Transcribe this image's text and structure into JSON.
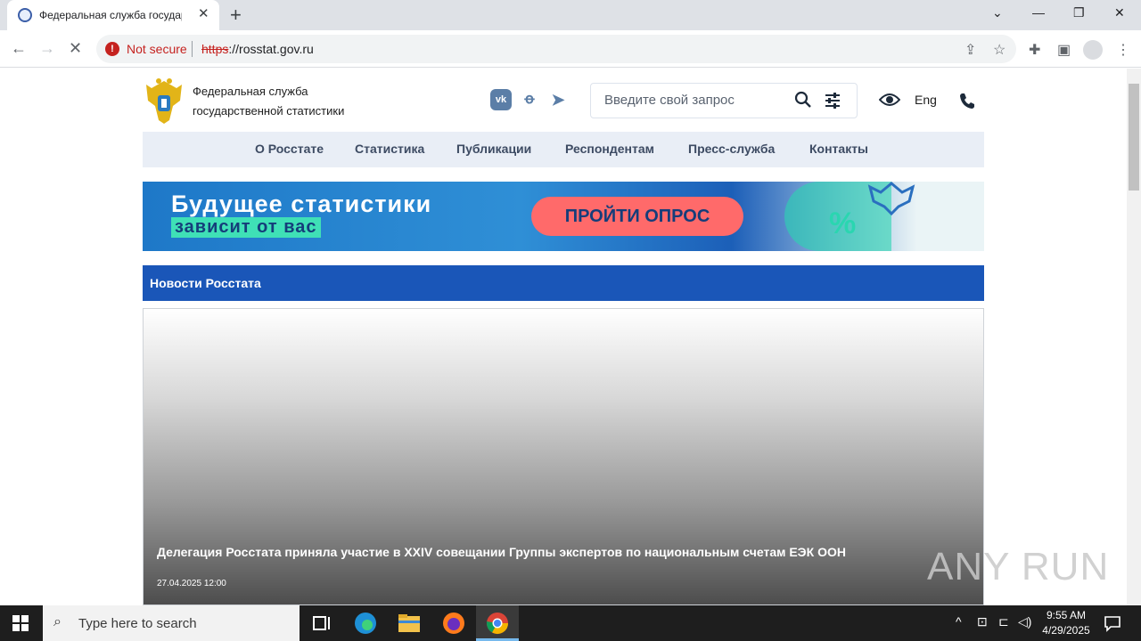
{
  "browser": {
    "tab_title": "Федеральная служба государс",
    "security_label": "Not secure",
    "url_protocol": "https",
    "url_rest": "://rosstat.gov.ru"
  },
  "site": {
    "org_name_line1": "Федеральная служба",
    "org_name_line2": "государственной статистики",
    "search_placeholder": "Введите свой запрос",
    "lang_label": "Eng",
    "social": [
      "VK",
      "OK",
      "Telegram"
    ],
    "menu": [
      "О Росстате",
      "Статистика",
      "Публикации",
      "Респондентам",
      "Пресс-служба",
      "Контакты"
    ]
  },
  "banner": {
    "line1": "Будущее статистики",
    "line2": "зависит от вас",
    "cta": "ПРОЙТИ ОПРОС",
    "percent_glyph": "%"
  },
  "news": {
    "section_title": "Новости Росстата",
    "headline": "Делегация Росстата приняла участие в XXIV совещании Группы экспертов по национальным счетам ЕЭК ООН",
    "date": "27.04.2025 12:00"
  },
  "watermark": "ANY RUN",
  "taskbar": {
    "search_placeholder": "Type here to search",
    "time": "9:55 AM",
    "date": "4/29/2025"
  },
  "colors": {
    "primary_blue": "#1a56b8",
    "menu_bg": "#e9eef6",
    "cta_red": "#ff6a6a",
    "insecure_red": "#c5221f"
  }
}
